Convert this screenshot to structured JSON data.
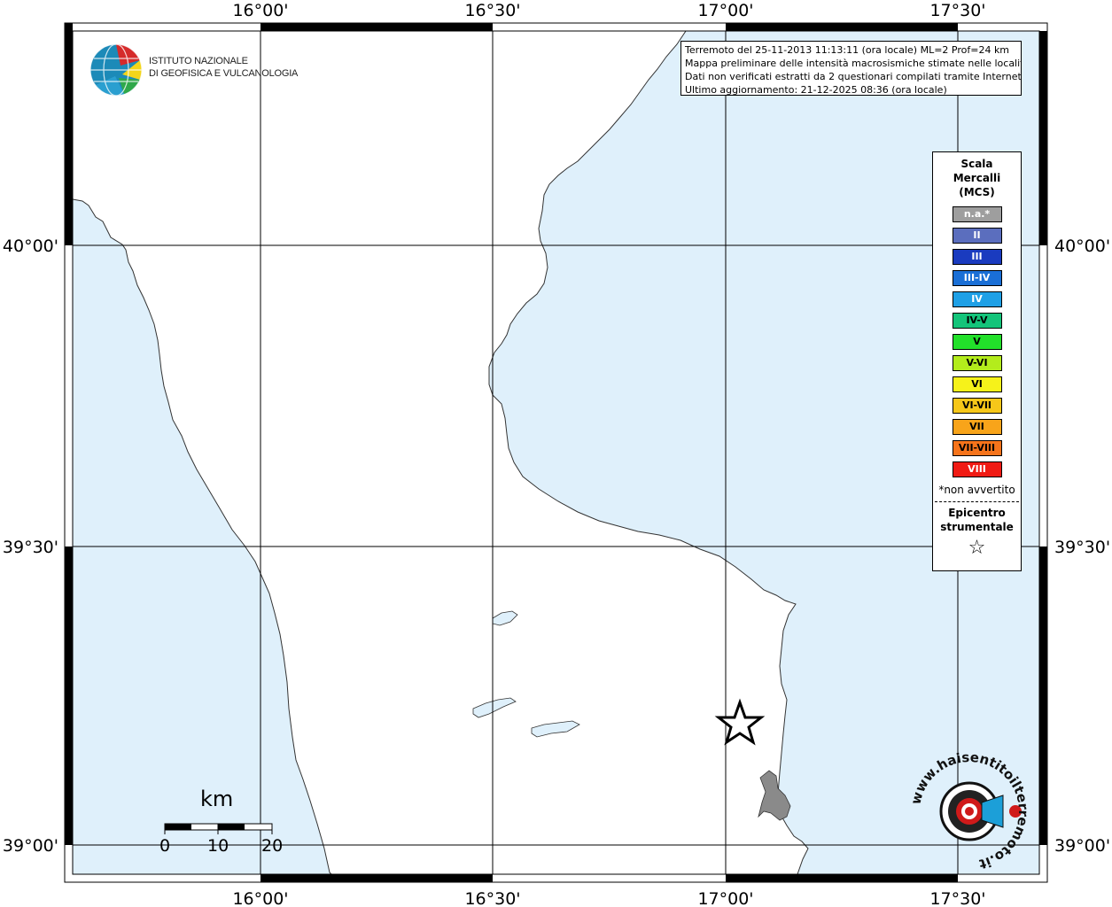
{
  "map": {
    "top_labels": [
      "16°00'",
      "16°30'",
      "17°00'",
      "17°30'"
    ],
    "bottom_labels": [
      "16°00'",
      "16°30'",
      "17°00'",
      "17°30'"
    ],
    "left_labels": [
      "40°00'",
      "39°30'",
      "39°00'"
    ],
    "right_labels": [
      "40°00'",
      "39°30'",
      "39°00'"
    ],
    "colors": {
      "sea": "#dff0fb",
      "land": "#ffffff",
      "grid": "#000000",
      "lake": "#8a8a8a"
    }
  },
  "info": {
    "line1": "Terremoto del 25-11-2013 11:13:11 (ora locale) ML=2 Prof=24 km",
    "line2": "Mappa preliminare delle intensità macrosismiche stimate nelle località",
    "line3": "Dati non verificati estratti da 2 questionari compilati tramite Internet.",
    "line4": "Ultimo aggiornamento: 21-12-2025 08:36 (ora locale)"
  },
  "legend": {
    "title_1": "Scala",
    "title_2": "Mercalli",
    "title_3": "(MCS)",
    "items": [
      {
        "label": "n.a.*",
        "color": "#9e9e9e",
        "text_color": "#ffffff"
      },
      {
        "label": "II",
        "color": "#5b6ebe",
        "text_color": "#ffffff"
      },
      {
        "label": "III",
        "color": "#1a3bbf",
        "text_color": "#ffffff"
      },
      {
        "label": "III-IV",
        "color": "#1a6fd6",
        "text_color": "#ffffff"
      },
      {
        "label": "IV",
        "color": "#1fa0e6",
        "text_color": "#ffffff"
      },
      {
        "label": "IV-V",
        "color": "#14c47a",
        "text_color": "#000000"
      },
      {
        "label": "V",
        "color": "#22e02a",
        "text_color": "#000000"
      },
      {
        "label": "V-VI",
        "color": "#b3ec1c",
        "text_color": "#000000"
      },
      {
        "label": "VI",
        "color": "#f6f21a",
        "text_color": "#000000"
      },
      {
        "label": "VI-VII",
        "color": "#f6c719",
        "text_color": "#000000"
      },
      {
        "label": "VII",
        "color": "#f8a41a",
        "text_color": "#000000"
      },
      {
        "label": "VII-VIII",
        "color": "#f6741b",
        "text_color": "#000000"
      },
      {
        "label": "VIII",
        "color": "#f01b14",
        "text_color": "#ffffff"
      }
    ],
    "note": "*non avvertito",
    "epicenter_1": "Epicentro",
    "epicenter_2": "strumentale"
  },
  "logo": {
    "ingv_line1": "ISTITUTO NAZIONALE",
    "ingv_line2": "DI GEOFISICA E VULCANOLOGIA",
    "hst_text": "www.haisentitoilterremoto.it"
  },
  "scale_bar": {
    "unit": "km",
    "ticks": [
      "0",
      "10",
      "20"
    ]
  }
}
